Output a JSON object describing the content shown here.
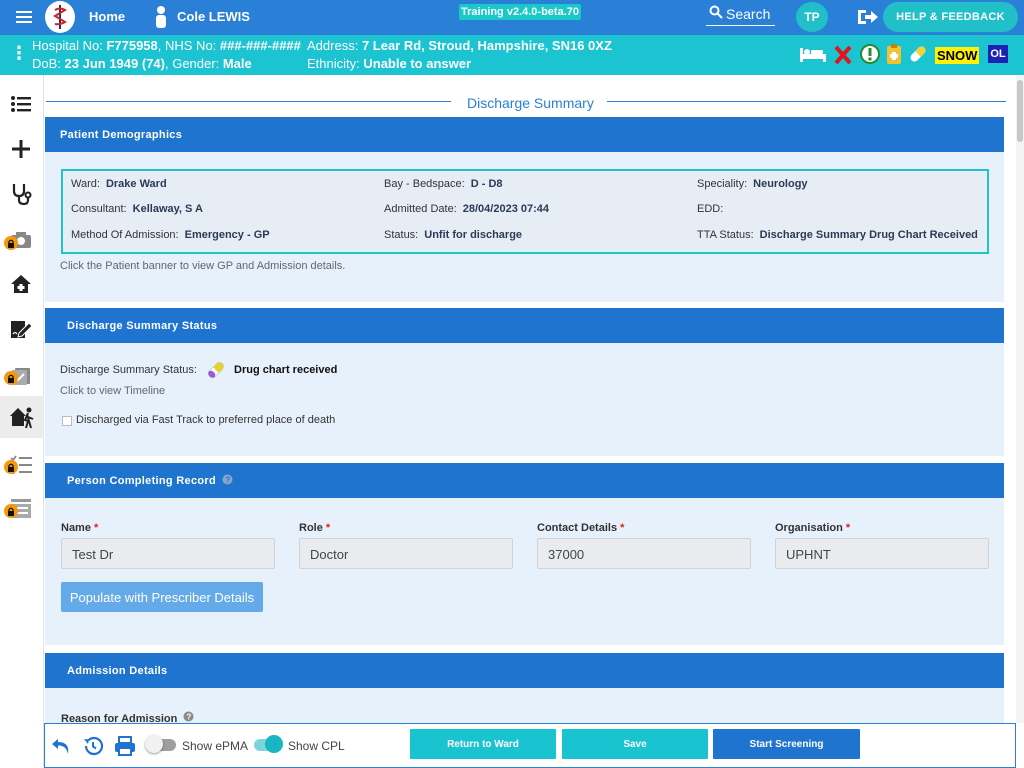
{
  "header": {
    "home_label": "Home",
    "patient_name": "Cole LEWIS",
    "training_label": "Training v2.4.0-beta.70",
    "search_label": "Search",
    "user_initials": "TP",
    "help_label": "HELP & FEEDBACK"
  },
  "banner": {
    "hospital_no_label": "Hospital No:",
    "hospital_no": "F775958",
    "nhs_label": "NHS No:",
    "nhs_no": "###-###-####",
    "address_label": "Address:",
    "address": "7 Lear Rd, Stroud, Hampshire, SN16 0XZ",
    "dob_label": "DoB:",
    "dob": "23 Jun 1949 (74)",
    "gender_label": "Gender:",
    "gender": "Male",
    "ethnicity_label": "Ethnicity:",
    "ethnicity": "Unable to answer",
    "snow_label": "SNOW",
    "ol_label": "OL"
  },
  "page": {
    "title": "Discharge Summary"
  },
  "demographics": {
    "heading": "Patient Demographics",
    "ward_label": "Ward:",
    "ward": "Drake Ward",
    "bay_label": "Bay - Bedspace:",
    "bay": "D - D8",
    "speciality_label": "Speciality:",
    "speciality": "Neurology",
    "consultant_label": "Consultant:",
    "consultant": "Kellaway, S A",
    "admitted_label": "Admitted Date:",
    "admitted": "28/04/2023 07:44",
    "edd_label": "EDD:",
    "edd": "",
    "method_label": "Method Of Admission:",
    "method": "Emergency - GP",
    "status_label": "Status:",
    "status": "Unfit for discharge",
    "tta_label": "TTA Status:",
    "tta": "Discharge Summary Drug Chart Received",
    "note": "Click the Patient banner to view GP and Admission details."
  },
  "discharge_status": {
    "heading": "Discharge Summary Status",
    "label": "Discharge Summary Status:",
    "value": "Drug chart received",
    "timeline_link": "Click to view Timeline",
    "fasttrack_label": "Discharged via Fast Track to preferred place of death",
    "fasttrack_checked": false
  },
  "person_completing": {
    "heading": "Person Completing Record",
    "name_label": "Name",
    "name_value": "Test Dr",
    "role_label": "Role",
    "role_value": "Doctor",
    "contact_label": "Contact Details",
    "contact_value": "37000",
    "org_label": "Organisation",
    "org_value": "UPHNT",
    "required_mark": "*",
    "populate_button": "Populate with Prescriber Details"
  },
  "admission_details": {
    "heading": "Admission Details",
    "reason_label": "Reason for Admission"
  },
  "footer": {
    "show_epma_label": "Show ePMA",
    "show_epma_on": false,
    "show_cpl_label": "Show CPL",
    "show_cpl_on": true,
    "return_button": "Return to Ward",
    "save_button": "Save",
    "start_screening_button": "Start Screening"
  },
  "colors": {
    "header_blue": "#2a7fd6",
    "banner_teal": "#1cc3d1",
    "panel_header": "#1f74cf",
    "panel_bg": "#e6f1fb",
    "accent_teal": "#19c3cf",
    "primary_button": "#1f74cf",
    "lock_orange": "#f49a0a"
  },
  "icons": [
    "hamburger-icon",
    "logo-icon",
    "person-icon",
    "search-icon",
    "logout-icon",
    "bed-icon",
    "red-cross-icon",
    "alert-icon",
    "clipboard-icon",
    "pill-icon",
    "list-icon",
    "plus-icon",
    "stethoscope-icon",
    "camera-icon",
    "home-medical-icon",
    "edit-signature-icon",
    "clipboard-check-icon",
    "discharge-walk-icon",
    "checklist-icon",
    "form-icon",
    "lock-icon",
    "undo-icon",
    "history-icon",
    "printer-icon",
    "help-icon"
  ]
}
